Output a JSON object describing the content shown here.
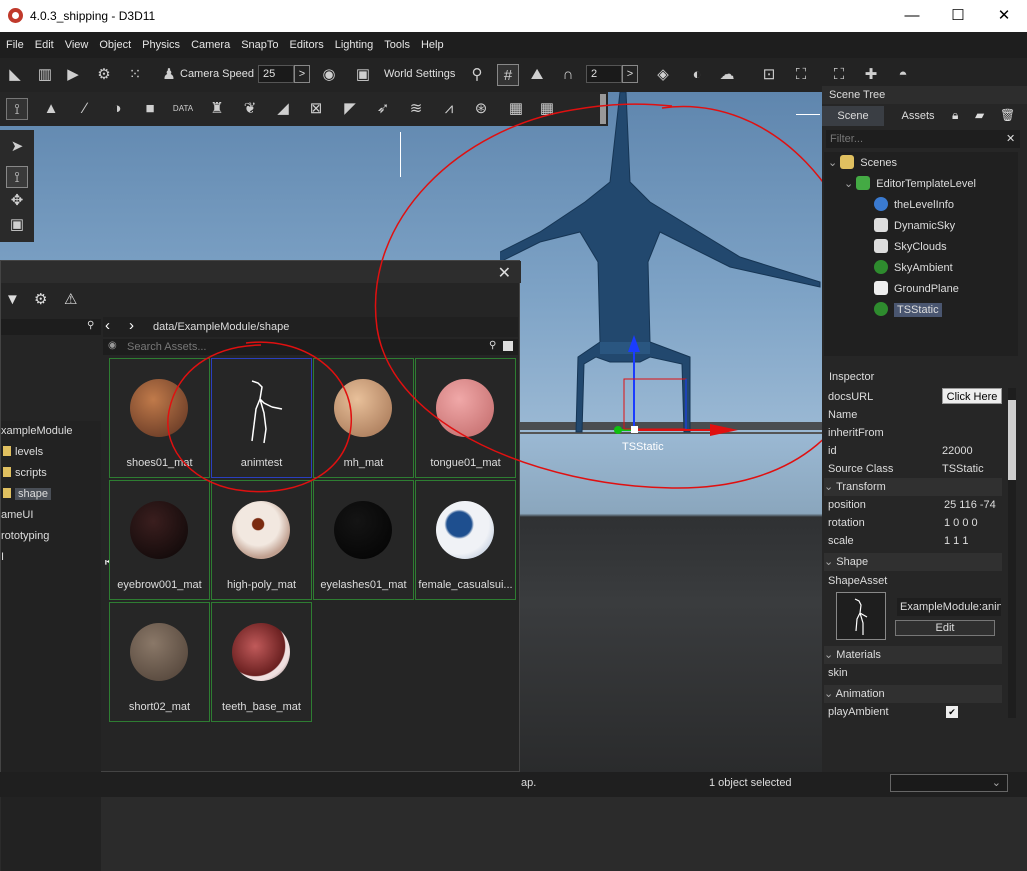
{
  "window": {
    "title": "4.0.3_shipping - D3D11",
    "minimize": "—",
    "maximize": "☐",
    "close": "✕"
  },
  "menu": [
    "File",
    "Edit",
    "View",
    "Object",
    "Physics",
    "Camera",
    "SnapTo",
    "Editors",
    "Lighting",
    "Tools",
    "Help"
  ],
  "toolbar": {
    "camera_speed_label": "Camera Speed",
    "camera_speed_value": "25",
    "world_settings_label": "World Settings",
    "grid_value": "2",
    "arrow": ">"
  },
  "viewport": {
    "object_label": "TSStatic"
  },
  "asset_browser": {
    "close": "✕",
    "path": "data/ExampleModule/shape",
    "search_placeholder": "Search Assets...",
    "tree": [
      {
        "label": "xampleModule",
        "folder": false,
        "indent": 0,
        "selected": false
      },
      {
        "label": "levels",
        "folder": true,
        "indent": 1,
        "selected": false
      },
      {
        "label": "scripts",
        "folder": true,
        "indent": 1,
        "selected": false
      },
      {
        "label": "shape",
        "folder": true,
        "indent": 1,
        "selected": true
      },
      {
        "label": "ameUI",
        "folder": false,
        "indent": 0,
        "selected": false
      },
      {
        "label": "rototyping",
        "folder": false,
        "indent": 0,
        "selected": false
      },
      {
        "label": "I",
        "folder": false,
        "indent": 0,
        "selected": false
      }
    ],
    "assets": [
      {
        "name": "shoes01_mat",
        "color": "#8a5a3a"
      },
      {
        "name": "animtest",
        "color": "#181818"
      },
      {
        "name": "mh_mat",
        "color": "#d0a07a"
      },
      {
        "name": "tongue01_mat",
        "color": "#e08a8a"
      },
      {
        "name": "eyebrow001_mat",
        "color": "#1a1212"
      },
      {
        "name": "high-poly_mat",
        "color": "#c9b8a8"
      },
      {
        "name": "eyelashes01_mat",
        "color": "#050505"
      },
      {
        "name": "female_casualsui...",
        "color": "#dde4ee"
      },
      {
        "name": "short02_mat",
        "color": "#6e5a4c"
      },
      {
        "name": "teeth_base_mat",
        "color": "#8a3a3a"
      }
    ]
  },
  "scene_tree": {
    "title": "Scene Tree",
    "tabs": [
      "Scene",
      "Assets"
    ],
    "filter_placeholder": "Filter...",
    "filter_clear": "✕",
    "items": [
      {
        "label": "Scenes",
        "icon": "folder-icon",
        "color": "#e0c060",
        "depth": 0
      },
      {
        "label": "EditorTemplateLevel",
        "icon": "level-icon",
        "color": "#44aa44",
        "depth": 1
      },
      {
        "label": "theLevelInfo",
        "icon": "info-icon",
        "color": "#3a7ad0",
        "depth": 2
      },
      {
        "label": "DynamicSky",
        "icon": "sky-icon",
        "color": "#ddd",
        "depth": 2
      },
      {
        "label": "SkyClouds",
        "icon": "clouds-icon",
        "color": "#ddd",
        "depth": 2
      },
      {
        "label": "SkyAmbient",
        "icon": "ambient-icon",
        "color": "#2e8b2e",
        "depth": 2
      },
      {
        "label": "GroundPlane",
        "icon": "grid-icon",
        "color": "#eee",
        "depth": 2
      },
      {
        "label": "TSStatic",
        "icon": "static-icon",
        "color": "#2e8b2e",
        "depth": 2
      }
    ]
  },
  "inspector": {
    "title": "Inspector",
    "fields": [
      {
        "label": "docsURL",
        "value": "Click Here"
      },
      {
        "label": "Name",
        "value": ""
      },
      {
        "label": "inheritFrom",
        "value": ""
      },
      {
        "label": "id",
        "value": "22000"
      },
      {
        "label": "Source Class",
        "value": "TSStatic"
      }
    ],
    "transform": {
      "title": "Transform",
      "position": "25 116 -74",
      "rotation": "1 0 0 0",
      "scale": "1 1 1",
      "position_label": "position",
      "rotation_label": "rotation",
      "scale_label": "scale"
    },
    "shape": {
      "title": "Shape",
      "asset_label": "ShapeAsset",
      "asset_value": "ExampleModule:anin",
      "edit": "Edit"
    },
    "materials": {
      "title": "Materials",
      "skin": "skin"
    },
    "animation": {
      "title": "Animation",
      "play_ambient": "playAmbient"
    }
  },
  "status": {
    "left_text": "ap.",
    "center_text": "1 object selected"
  }
}
